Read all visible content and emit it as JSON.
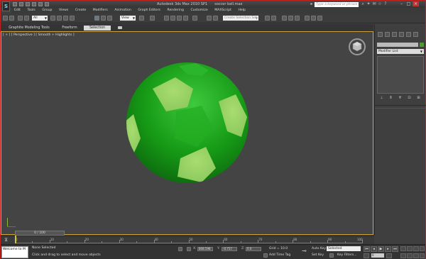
{
  "window": {
    "app_title": "Autodesk 3ds Max 2010 SP1",
    "file_title": "soccer ball.max",
    "search_placeholder": "Type a keyword or phrase",
    "logo": "3ds-max-logo"
  },
  "menu": [
    "Edit",
    "Tools",
    "Group",
    "Views",
    "Create",
    "Modifiers",
    "Animation",
    "Graph Editors",
    "Rendering",
    "Customize",
    "MAXScript",
    "Help"
  ],
  "toolbar": {
    "selection_filter": "All",
    "reference_coord": "View",
    "named_selection_placeholder": "Create Selection Set"
  },
  "ribbon": {
    "tabs": [
      "Graphite Modeling Tools",
      "Freeform",
      "Selection"
    ],
    "active_tab": "Selection"
  },
  "viewport": {
    "label": "[ + ] [ Perspective ] [ Smooth + Highlights ]",
    "background": "#444444",
    "border_color": "#c9a23a",
    "object": "soccer ball",
    "ball_colors": {
      "dark": "#0f7a10",
      "mid": "#21a321",
      "light_patch": "#9ed56a"
    }
  },
  "command_panel": {
    "modifier_list": "Modifier List",
    "object_color": "#4ba02a"
  },
  "timeline": {
    "frame_slider": "0 / 100",
    "ticks": [
      "0",
      "5",
      "10",
      "15",
      "20",
      "25",
      "30",
      "35",
      "40",
      "45",
      "50",
      "55",
      "60",
      "65",
      "70",
      "75",
      "80",
      "85",
      "90",
      "95",
      "100"
    ]
  },
  "status": {
    "maxscript": "Welcome to M",
    "selection": "None Selected",
    "prompt": "Click and drag to select and move objects",
    "x_label": "X:",
    "x_value": "808.598",
    "y_label": "Y:",
    "y_value": "-0.757",
    "z_label": "Z:",
    "z_value": "0.0",
    "grid": "Grid = 10.0",
    "add_time_tag": "Add Time Tag",
    "auto_key": "Auto Key",
    "set_key": "Set Key",
    "key_mode": "Selected",
    "key_filters": "Key Filters...",
    "current_frame": "0"
  }
}
